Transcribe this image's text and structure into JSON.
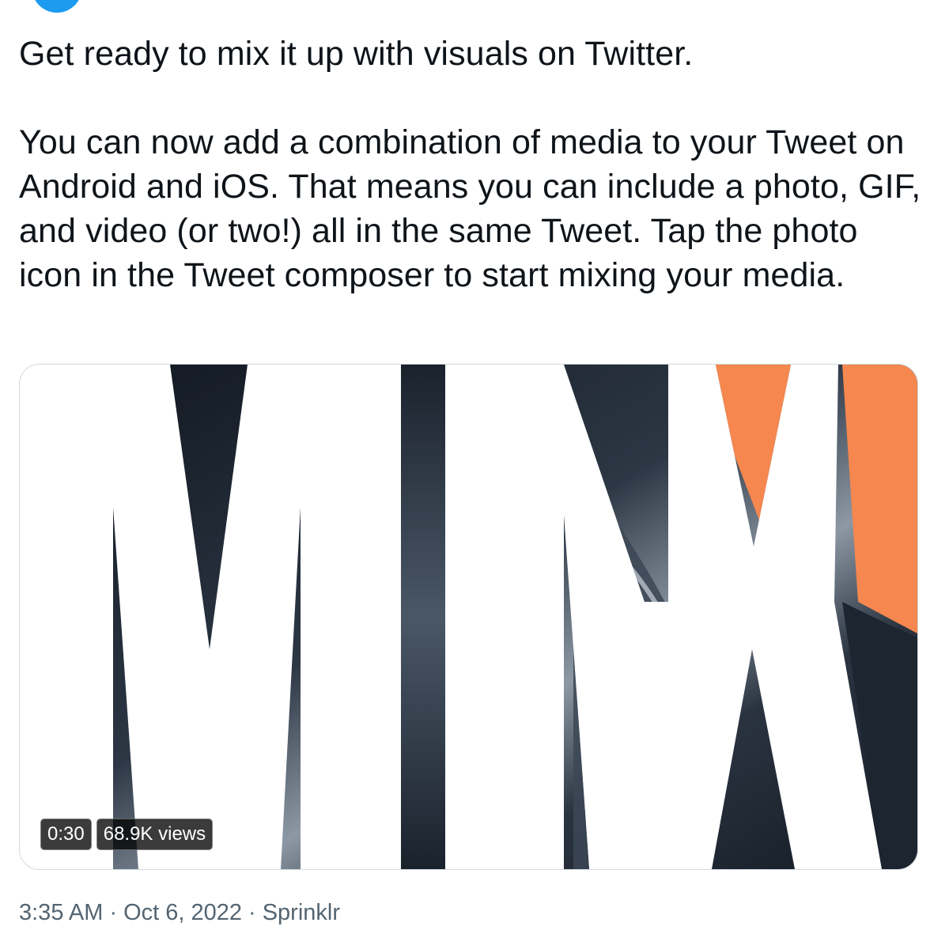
{
  "tweet": {
    "paragraphs": [
      "Get ready to mix it up with visuals on Twitter.",
      "You can now add a combination of media to your Tweet on Android and iOS. That means you can include a photo, GIF, and video (or two!) all in the same Tweet. Tap the photo icon in the Tweet composer to start mixing your media."
    ]
  },
  "media": {
    "type": "video",
    "duration": "0:30",
    "views": "68.9K views",
    "colors": {
      "dark": "#1d2530",
      "mid": "#3a4656",
      "highlight": "#aab4bf",
      "orange": "#f5874f"
    }
  },
  "meta": {
    "time": "3:35 AM",
    "separator": "·",
    "date": "Oct 6, 2022",
    "source": "Sprinklr"
  },
  "colors": {
    "text": "#0f1419",
    "secondary": "#536471",
    "brand": "#1d9bf0",
    "border": "#cfd9de"
  }
}
